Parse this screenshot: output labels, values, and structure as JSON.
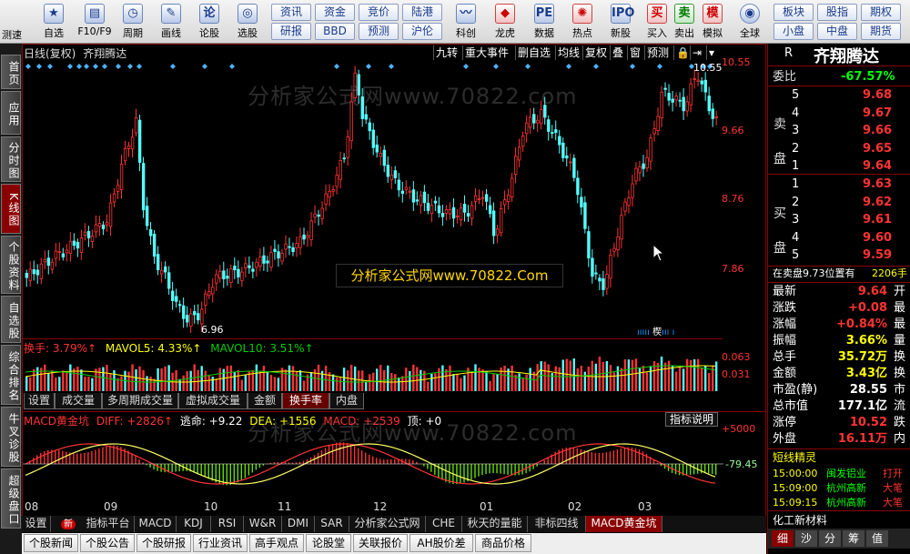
{
  "toolbar": {
    "items": [
      {
        "label": "测速",
        "icon": "speed-icon"
      },
      {
        "label": "自选",
        "icon": "star-icon"
      },
      {
        "label": "F10/F9",
        "icon": "f10-icon"
      },
      {
        "label": "周期",
        "icon": "clock-icon"
      },
      {
        "label": "画线",
        "icon": "pencil-icon"
      },
      {
        "label": "论股",
        "icon": "discuss-icon"
      },
      {
        "label": "选股",
        "icon": "pick-stock-icon"
      }
    ],
    "buttons_row1": [
      "资讯",
      "资金",
      "竞价",
      "陆港"
    ],
    "buttons_row2": [
      "研报",
      "BBD",
      "预测",
      "沪伦"
    ],
    "items2": [
      {
        "label": "科创",
        "icon": "kechuang-icon"
      },
      {
        "label": "龙虎",
        "icon": "dragon-tiger-icon"
      },
      {
        "label": "数据",
        "icon": "data-icon"
      },
      {
        "label": "热点",
        "icon": "hot-icon"
      },
      {
        "label": "新股",
        "icon": "ipo-icon"
      }
    ],
    "trade": [
      {
        "label": "买入",
        "glyph": "买"
      },
      {
        "label": "卖出",
        "glyph": "卖"
      },
      {
        "label": "模拟",
        "glyph": "模"
      }
    ],
    "globe_label": "全球",
    "right_row1": [
      "板块",
      "股指",
      "期权"
    ],
    "right_row2": [
      "小盘",
      "中盘",
      "期货"
    ]
  },
  "sidebar": [
    "首页",
    "应用",
    "分时图",
    "K线图",
    "个股资料",
    "自选股",
    "综合排名",
    "牛叉诊股",
    "超级盘口"
  ],
  "chart": {
    "header_left": "日线(复权)",
    "stock_name": "齐翔腾达",
    "top_buttons": [
      "九转",
      "重大事件",
      "删自选",
      "均线",
      "复权",
      "叠",
      "窗",
      "预测"
    ],
    "price_axis": [
      "10.55",
      "9.66",
      "8.76",
      "7.86"
    ],
    "high_label": "10.55",
    "low_label": "6.96",
    "watermark": "分析家公式网www.70822.com",
    "overlay_text": "分析家公式网www.70822.Com"
  },
  "volume": {
    "label_turnover": "换手: 3.79%↑",
    "label_mavol5": "MAVOL5: 4.33%↑",
    "label_mavol10": "MAVOL10: 3.51%↑",
    "axis": [
      "0.063",
      "0.031"
    ]
  },
  "tabs1": [
    "设置",
    "成交量",
    "多周期成交量",
    "虚拟成交量",
    "金额",
    "换手率",
    "内盘"
  ],
  "macd": {
    "title": "MACD黄金坑",
    "diff": "DIFF: +2826↑",
    "escape": "逃命: +9.22",
    "dea": "DEA: +1556",
    "macd": "MACD: +2539",
    "top": "顶: +0",
    "axis_top": "+5000",
    "axis_bottom": "-79.45",
    "help": "指标说明"
  },
  "dates": [
    "08",
    "09",
    "10",
    "11",
    "12",
    "01",
    "02",
    "03"
  ],
  "bottom_tabs": [
    "设置",
    "新",
    "指标平台",
    "MACD",
    "KDJ",
    "RSI",
    "W&R",
    "DMI",
    "SAR",
    "分析家公式网",
    "CHE",
    "秋天的量能",
    "非标四线",
    "MACD黄金坑"
  ],
  "bottom_tabs2": [
    "个股新闻",
    "个股公告",
    "个股研报",
    "行业资讯",
    "高手观点",
    "论股堂",
    "关联报价",
    "AH股价差",
    "商品价格"
  ],
  "panel": {
    "code_label": "R",
    "name": "齐翔腾达",
    "weibi_label": "委比",
    "weibi": "-67.57%",
    "sell_label": "卖盘",
    "buy_label": "买盘",
    "sells": [
      {
        "n": "5",
        "p": "9.68"
      },
      {
        "n": "4",
        "p": "9.67"
      },
      {
        "n": "3",
        "p": "9.66"
      },
      {
        "n": "2",
        "p": "9.65"
      },
      {
        "n": "1",
        "p": "9.64"
      }
    ],
    "buys": [
      {
        "n": "1",
        "p": "9.63"
      },
      {
        "n": "2",
        "p": "9.62"
      },
      {
        "n": "3",
        "p": "9.61"
      },
      {
        "n": "4",
        "p": "9.60"
      },
      {
        "n": "5",
        "p": "9.59"
      }
    ],
    "sell_note": "在卖盘9.73位置有",
    "sell_note_val": "2206手",
    "stats": [
      {
        "k": "最新",
        "v": "9.64",
        "t": "开"
      },
      {
        "k": "涨跌",
        "v": "+0.08",
        "t": "最"
      },
      {
        "k": "涨幅",
        "v": "+0.84%",
        "t": "最"
      },
      {
        "k": "振幅",
        "v": "3.66%",
        "t": "量"
      },
      {
        "k": "总手",
        "v": "35.72万",
        "t": "换"
      },
      {
        "k": "金额",
        "v": "3.43亿",
        "t": "换"
      },
      {
        "k": "市盈(静)",
        "v": "28.55",
        "t": "市"
      },
      {
        "k": "总市值",
        "v": "177.1亿",
        "t": "流"
      },
      {
        "k": "涨停",
        "v": "10.52",
        "t": "跌"
      },
      {
        "k": "外盘",
        "v": "16.11万",
        "t": "内"
      }
    ],
    "spirit_title": "短线精灵",
    "spirit": [
      {
        "time": "15:00:00",
        "name": "闽发铝业",
        "act": "打开"
      },
      {
        "time": "15:09:00",
        "name": "杭州高新",
        "act": "大笔"
      },
      {
        "time": "15:09:15",
        "name": "杭州高新",
        "act": "大笔"
      }
    ],
    "footer": "化工新材料",
    "bottom_tabs": [
      "细",
      "沙",
      "分",
      "筹",
      "值"
    ]
  }
}
